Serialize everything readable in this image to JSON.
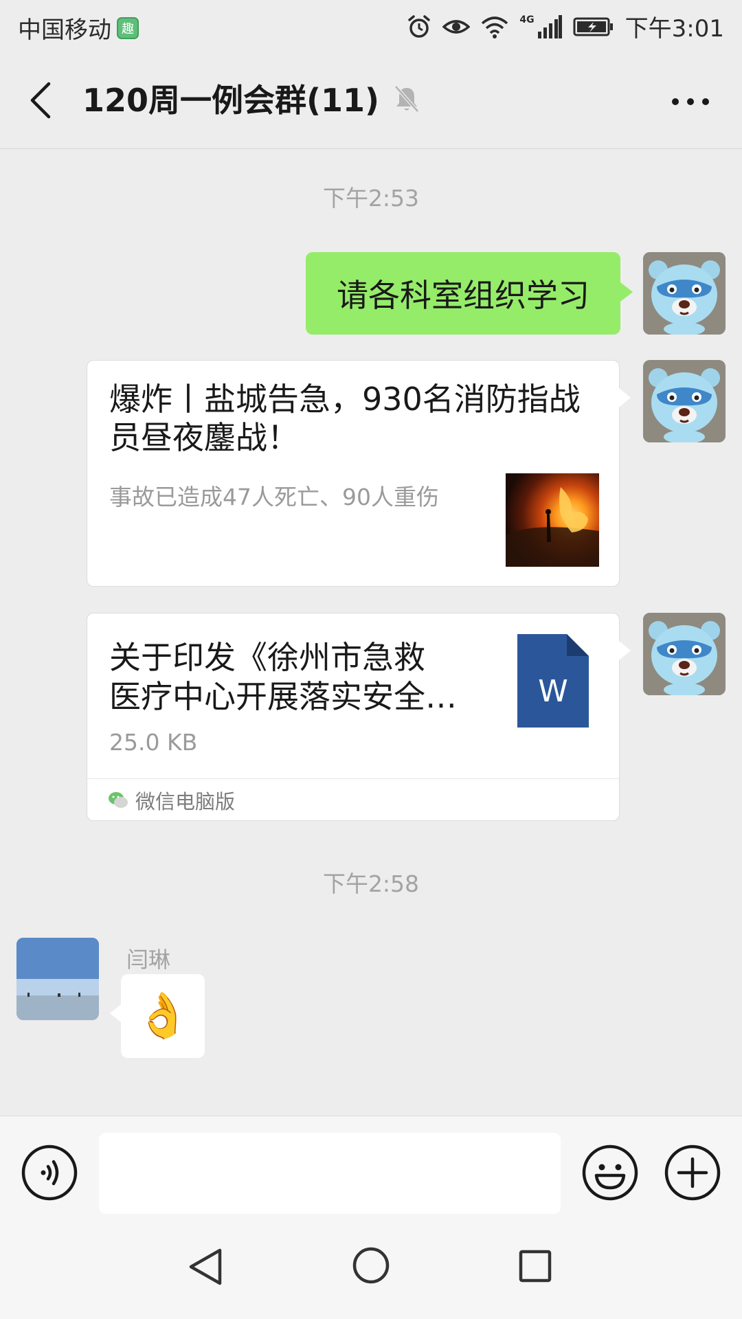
{
  "status_bar": {
    "carrier": "中国移动",
    "carrier_badge": "趣",
    "network": "4G",
    "time": "下午3:01",
    "icons": [
      "alarm-icon",
      "eye-icon",
      "wifi-icon",
      "signal-icon",
      "battery-icon"
    ]
  },
  "nav": {
    "title": "120周一例会群(11)",
    "muted": true,
    "icons": [
      "back-arrow-icon",
      "bell-muted-icon",
      "more-dots-icon"
    ]
  },
  "messages": {
    "timestamp_1": "下午2:53",
    "text_message": "请各科室组织学习",
    "link_card": {
      "title": "爆炸丨盐城告急，930名消防指战员昼夜鏖战！",
      "description": "事故已造成47人死亡、90人重伤"
    },
    "file_card": {
      "title_line_1": "关于印发《徐州市急救",
      "title_line_2": "医疗中心开展落实安全…",
      "size": "25.0 KB",
      "file_badge": "W",
      "source": "微信电脑版"
    },
    "timestamp_2": "下午2:58",
    "incoming": {
      "sender": "闫琳",
      "emoji": "👌"
    }
  },
  "input_bar": {
    "placeholder": "",
    "icons": [
      "voice-icon",
      "emoji-icon",
      "plus-icon"
    ]
  },
  "colors": {
    "background": "#ededed",
    "sent_bubble": "#95ec69",
    "word_blue": "#2b579a"
  }
}
